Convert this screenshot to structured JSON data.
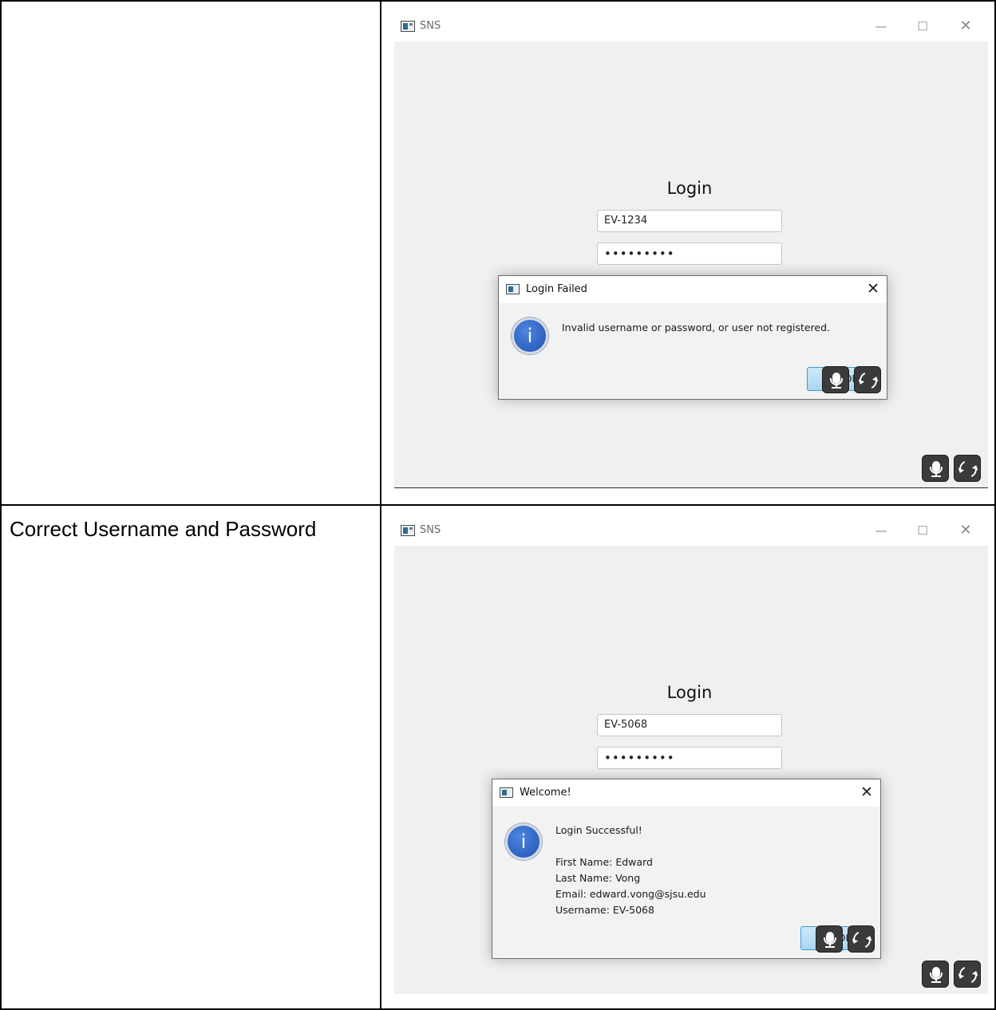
{
  "doc": {
    "row2_label": "Correct Username and Password"
  },
  "window1": {
    "title": "SNS",
    "icon": "app-window-icon",
    "controls": {
      "minimize": "—",
      "maximize": "☐",
      "close": "✕"
    },
    "login_heading": "Login",
    "username_value": "EV-1234",
    "password_value": "•••••••••",
    "dialog": {
      "title": "Login Failed",
      "close": "✕",
      "icon": "info-icon",
      "icon_glyph": "i",
      "message": "Invalid username or password, or user not registered.",
      "ok_label": "OK"
    }
  },
  "window2": {
    "title": "SNS",
    "icon": "app-window-icon",
    "controls": {
      "minimize": "—",
      "maximize": "☐",
      "close": "✕"
    },
    "login_heading": "Login",
    "username_value": "EV-5068",
    "password_value": "•••••••••",
    "dialog": {
      "title": "Welcome!",
      "close": "✕",
      "icon": "info-icon",
      "icon_glyph": "i",
      "message_lines": [
        "Login Successful!",
        "First Name: Edward",
        "Last Name: Vong",
        "Email: edward.vong@sjsu.edu",
        "Username: EV-5068"
      ],
      "ok_label": "OK"
    }
  },
  "overlay_tools": [
    "mic-icon",
    "refresh-icon"
  ],
  "colors": {
    "client_bg": "#f0f0f0",
    "ok_button": "#a9d6f2",
    "info_icon": "#1f52b3",
    "tool_button": "#3b3b3b"
  }
}
